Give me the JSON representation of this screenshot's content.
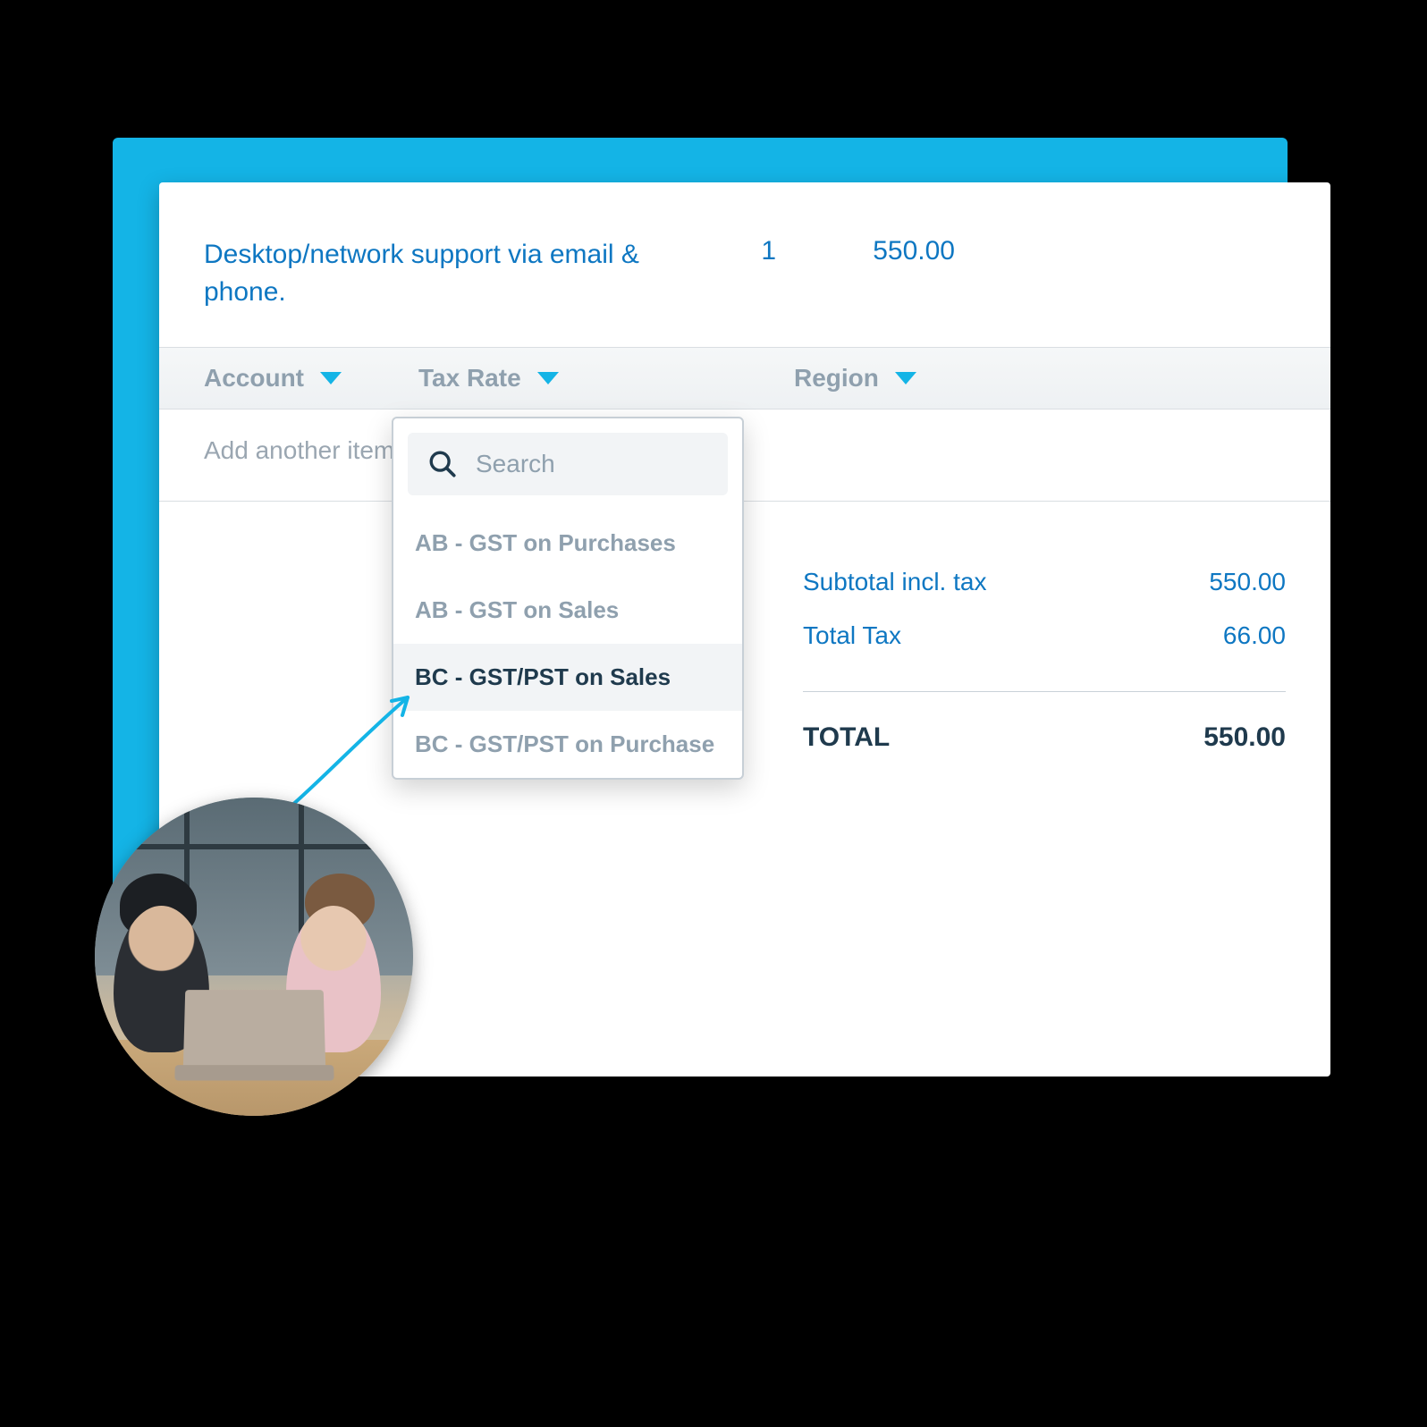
{
  "line_item": {
    "description": "Desktop/network support via email & phone.",
    "qty": "1",
    "amount": "550.00"
  },
  "columns": {
    "account": "Account",
    "tax_rate": "Tax Rate",
    "region": "Region"
  },
  "add_item_placeholder": "Add another item...",
  "dropdown": {
    "search_placeholder": "Search",
    "options": [
      "AB - GST on Purchases",
      "AB - GST on Sales",
      "BC - GST/PST on Sales",
      "BC - GST/PST on Purchase"
    ],
    "selected_index": 2
  },
  "totals": {
    "subtotal_label": "Subtotal incl. tax",
    "subtotal_value": "550.00",
    "tax_label": "Total Tax",
    "tax_value": "66.00",
    "total_label": "TOTAL",
    "total_value": "550.00"
  },
  "colors": {
    "accent": "#14B4E6",
    "link": "#0E77C2"
  }
}
